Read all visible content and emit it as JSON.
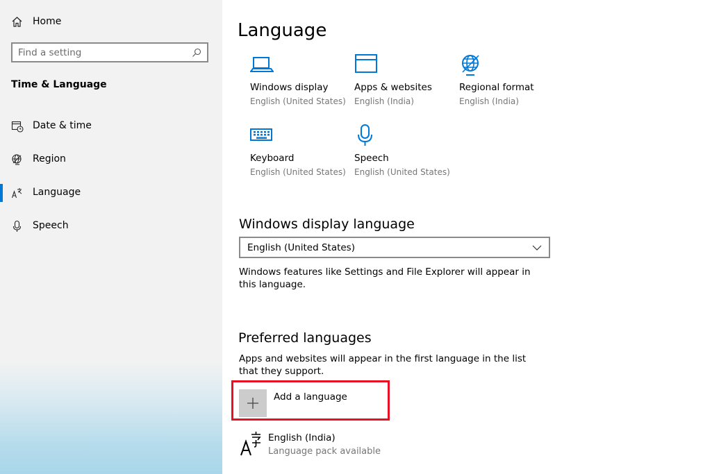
{
  "sidebar": {
    "home_label": "Home",
    "search_placeholder": "Find a setting",
    "section_title": "Time & Language",
    "items": [
      {
        "label": "Date & time",
        "icon": "calendar-clock-icon"
      },
      {
        "label": "Region",
        "icon": "globe-icon"
      },
      {
        "label": "Language",
        "icon": "language-icon",
        "active": true
      },
      {
        "label": "Speech",
        "icon": "microphone-icon"
      }
    ]
  },
  "main": {
    "title": "Language",
    "tiles": [
      {
        "name": "Windows display",
        "sub": "English (United States)",
        "icon": "laptop-icon"
      },
      {
        "name": "Apps & websites",
        "sub": "English (India)",
        "icon": "window-icon"
      },
      {
        "name": "Regional format",
        "sub": "English (India)",
        "icon": "globe-grid-icon"
      },
      {
        "name": "Keyboard",
        "sub": "English (United States)",
        "icon": "keyboard-icon"
      },
      {
        "name": "Speech",
        "sub": "English (United States)",
        "icon": "microphone-icon"
      }
    ],
    "display_language": {
      "heading": "Windows display language",
      "selected": "English (United States)",
      "description": "Windows features like Settings and File Explorer will appear in this language."
    },
    "preferred": {
      "heading": "Preferred languages",
      "description": "Apps and websites will appear in the first language in the list that they support.",
      "add_label": "Add a language",
      "languages": [
        {
          "name": "English (India)",
          "status": "Language pack available"
        }
      ]
    }
  },
  "colors": {
    "accent": "#0078d7",
    "highlight": "#e81123",
    "muted_text": "#767676"
  }
}
